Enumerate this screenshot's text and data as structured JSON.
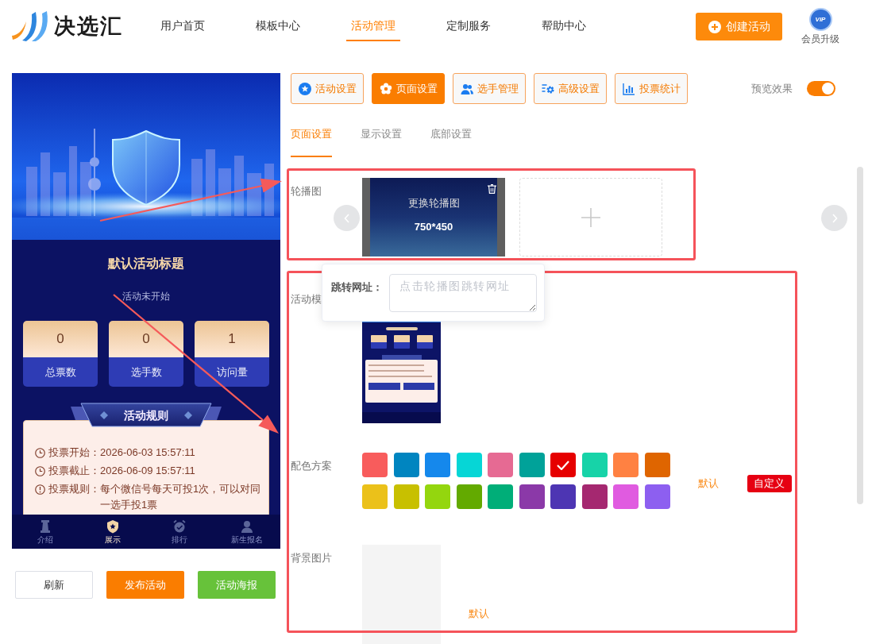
{
  "header": {
    "logo": "决选汇",
    "nav": [
      {
        "label": "用户首页",
        "selected": false
      },
      {
        "label": "模板中心",
        "selected": false
      },
      {
        "label": "活动管理",
        "selected": true
      },
      {
        "label": "定制服务",
        "selected": false
      },
      {
        "label": "帮助中心",
        "selected": false
      }
    ],
    "create_button": "创建活动",
    "vip_badge": "VIP",
    "vip_label": "会员升级"
  },
  "preview": {
    "title": "默认活动标题",
    "status": "活动未开始",
    "stats": [
      {
        "value": "0",
        "label": "总票数"
      },
      {
        "value": "0",
        "label": "选手数"
      },
      {
        "value": "1",
        "label": "访问量"
      }
    ],
    "rules_heading": "活动规则",
    "rules": [
      {
        "kind": "time",
        "label": "投票开始：",
        "value": "2026-06-03 15:57:11"
      },
      {
        "kind": "time",
        "label": "投票截止：",
        "value": "2026-06-09 15:57:11"
      },
      {
        "kind": "info",
        "label": "投票规则：",
        "value": "每个微信号每天可投1次，可以对同一选手投1票"
      }
    ],
    "bottom_nav": [
      {
        "label": "介绍",
        "selected": false
      },
      {
        "label": "展示",
        "selected": true
      },
      {
        "label": "排行",
        "selected": false
      },
      {
        "label": "新生报名",
        "selected": false
      }
    ]
  },
  "actions": [
    {
      "kind": "default",
      "label": "刷新"
    },
    {
      "kind": "primary",
      "label": "发布活动"
    },
    {
      "kind": "success",
      "label": "活动海报"
    }
  ],
  "settings_tabs": [
    {
      "label": "活动设置",
      "selected": false
    },
    {
      "label": "页面设置",
      "selected": true
    },
    {
      "label": "选手管理",
      "selected": false
    },
    {
      "label": "高级设置",
      "selected": false
    },
    {
      "label": "投票统计",
      "selected": false
    }
  ],
  "preview_toggle": {
    "label": "预览效果",
    "on": true
  },
  "sub_tabs": [
    {
      "label": "页面设置",
      "selected": true
    },
    {
      "label": "显示设置",
      "selected": false
    },
    {
      "label": "底部设置",
      "selected": false
    }
  ],
  "carousel": {
    "label": "轮播图",
    "slides": [
      {
        "caption": "更换轮播图",
        "size": "750*450"
      }
    ]
  },
  "link_popover": {
    "label": "跳转网址：",
    "placeholder": "点击轮播图跳转网址"
  },
  "template": {
    "label": "活动模"
  },
  "color_scheme": {
    "label": "配色方案",
    "colors": [
      {
        "color": "#f85c5c",
        "selected": false
      },
      {
        "color": "#0085c0",
        "selected": false
      },
      {
        "color": "#1588ec",
        "selected": false
      },
      {
        "color": "#06d6d6",
        "selected": false
      },
      {
        "color": "#e66a93",
        "selected": false
      },
      {
        "color": "#00a299",
        "selected": false
      },
      {
        "color": "#e60000",
        "selected": true
      },
      {
        "color": "#17d3a8",
        "selected": false
      },
      {
        "color": "#ff8142",
        "selected": false
      },
      {
        "color": "#df6500",
        "selected": false
      },
      {
        "color": "#ebc11a",
        "selected": false
      },
      {
        "color": "#c8c000",
        "selected": false
      },
      {
        "color": "#94d60e",
        "selected": false
      },
      {
        "color": "#63aa00",
        "selected": false
      },
      {
        "color": "#00ae78",
        "selected": false
      },
      {
        "color": "#8b39a8",
        "selected": false
      },
      {
        "color": "#4d35b3",
        "selected": false
      },
      {
        "color": "#a52870",
        "selected": false
      },
      {
        "color": "#e05be0",
        "selected": false
      },
      {
        "color": "#8d5ff0",
        "selected": false
      }
    ],
    "default_link": "默认",
    "custom_button": "自定义"
  },
  "background": {
    "label": "背景图片",
    "default_link": "默认"
  }
}
